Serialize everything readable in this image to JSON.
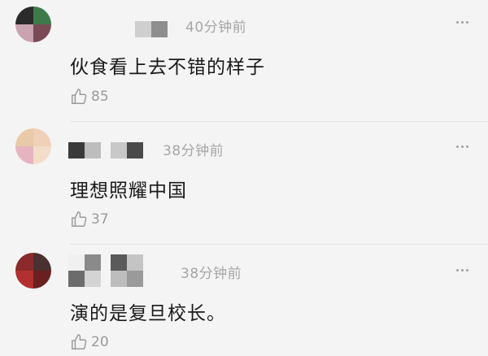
{
  "comments": [
    {
      "time": "40分钟前",
      "text": "伙食看上去不错的样子",
      "likes": "85",
      "avatar_colors": [
        "#2b2b2b",
        "#3d7a4a",
        "#c9a3b0",
        "#7a4a55"
      ]
    },
    {
      "time": "38分钟前",
      "text": "理想照耀中国",
      "likes": "37",
      "avatar_colors": [
        "#e8c9a8",
        "#f0d0b8",
        "#e6b4c0",
        "#f3dcc8"
      ]
    },
    {
      "time": "38分钟前",
      "text": "演的是复旦校长。",
      "likes": "20",
      "avatar_colors": [
        "#8a2a2a",
        "#4a3030",
        "#b23030",
        "#6a2020"
      ]
    }
  ],
  "icons": {
    "like": "thumbs-up-icon",
    "more": "more-dots-icon"
  }
}
